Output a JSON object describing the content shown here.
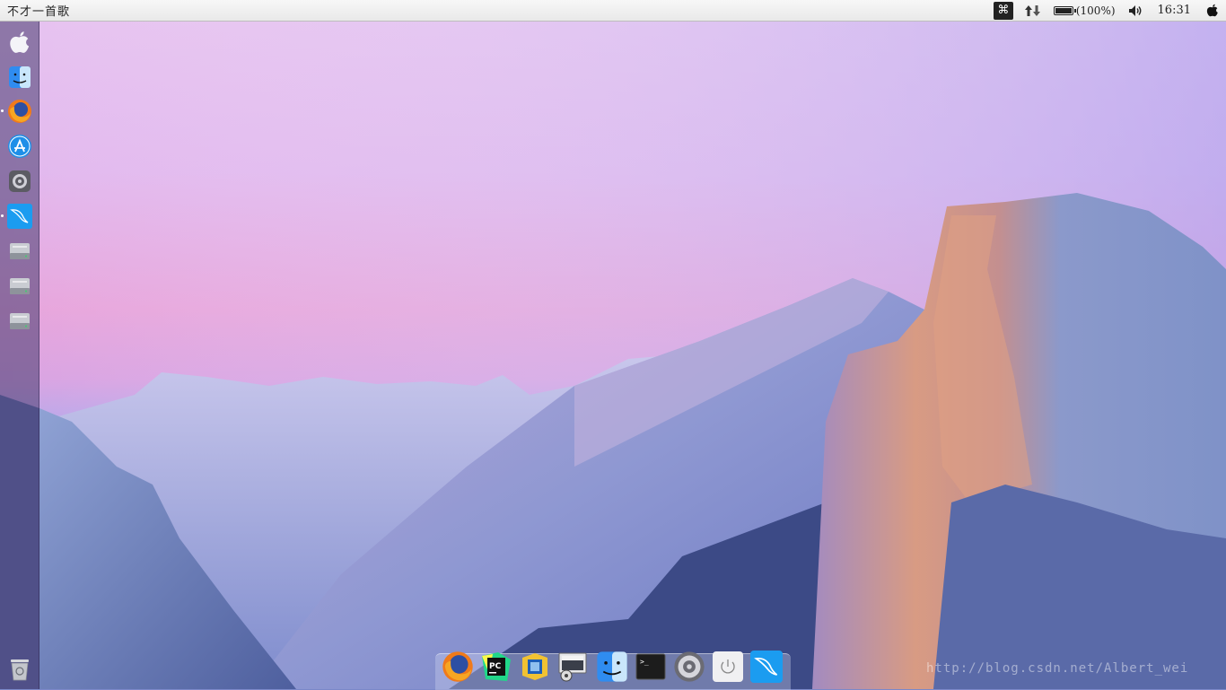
{
  "top_panel": {
    "title": "不才一首歌",
    "cmd_key_label": "⌘",
    "network_icon": "network-arrows-icon",
    "battery": {
      "level": 1.0,
      "label": "(100%)"
    },
    "volume_icon": "speaker-icon",
    "clock": "16:31",
    "apple_menu_icon": "apple-icon"
  },
  "launcher": {
    "items": [
      {
        "name": "apple-logo",
        "icon": "apple-icon",
        "running": false
      },
      {
        "name": "finder",
        "icon": "finder-icon",
        "running": false
      },
      {
        "name": "firefox",
        "icon": "firefox-icon",
        "running": true
      },
      {
        "name": "app-store",
        "icon": "app-store-icon",
        "running": false
      },
      {
        "name": "system-settings",
        "icon": "gear-icon",
        "running": false
      },
      {
        "name": "mysql-workbench",
        "icon": "dolphin-icon",
        "running": true
      },
      {
        "name": "drive-1",
        "icon": "hard-drive-icon",
        "running": false
      },
      {
        "name": "drive-2",
        "icon": "hard-drive-icon",
        "running": false
      },
      {
        "name": "drive-3",
        "icon": "hard-drive-icon",
        "running": false
      },
      {
        "name": "trash",
        "icon": "trash-icon",
        "running": false
      }
    ]
  },
  "dock": {
    "items": [
      {
        "name": "firefox",
        "icon": "firefox-icon"
      },
      {
        "name": "pycharm",
        "icon": "pycharm-icon",
        "label": "PC"
      },
      {
        "name": "virtualbox",
        "icon": "virtualbox-icon"
      },
      {
        "name": "screenshot-tool",
        "icon": "screenshot-icon"
      },
      {
        "name": "finder",
        "icon": "finder-icon"
      },
      {
        "name": "terminal",
        "icon": "terminal-icon",
        "label": ">_"
      },
      {
        "name": "system-settings",
        "icon": "gear-icon"
      },
      {
        "name": "power",
        "icon": "power-icon"
      },
      {
        "name": "mysql-workbench",
        "icon": "dolphin-icon"
      }
    ]
  },
  "watermark": "http://blog.csdn.net/Albert_wei",
  "colors": {
    "sky_top": "#e9c2ef",
    "sky_pink": "#e6a8dd",
    "mountain_blue": "#6f7fc6",
    "half_dome_orange": "#d79c7f"
  }
}
